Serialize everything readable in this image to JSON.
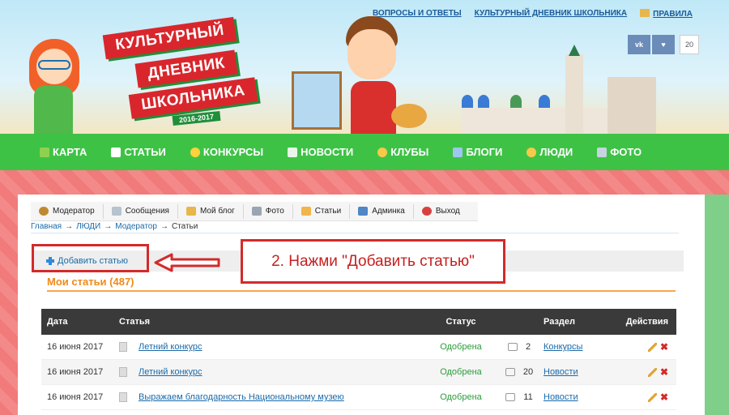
{
  "header": {
    "top_links": [
      "ВОПРОСЫ И ОТВЕТЫ",
      "КУЛЬТУРНЫЙ ДНЕВНИК ШКОЛЬНИКА",
      "ПРАВИЛА"
    ],
    "logo_lines": [
      "КУЛЬТУРНЫЙ",
      "ДНЕВНИК",
      "ШКОЛЬНИКА"
    ],
    "logo_year": "2016-2017",
    "social": {
      "vk": "vk",
      "like": "♥",
      "count": "20"
    }
  },
  "nav": [
    {
      "label": "КАРТА",
      "icon": "check-icon",
      "color": "#8fd14f"
    },
    {
      "label": "СТАТЬИ",
      "icon": "page-icon",
      "color": "#ffffff"
    },
    {
      "label": "КОНКУРСЫ",
      "icon": "bulb-icon",
      "color": "#ffd23c"
    },
    {
      "label": "НОВОСТИ",
      "icon": "doc-icon",
      "color": "#e8f5e8"
    },
    {
      "label": "КЛУБЫ",
      "icon": "people-icon",
      "color": "#f7c94b"
    },
    {
      "label": "БЛОГИ",
      "icon": "list-icon",
      "color": "#9ec7f0"
    },
    {
      "label": "ЛЮДИ",
      "icon": "people-icon",
      "color": "#f7c94b"
    },
    {
      "label": "ФОТО",
      "icon": "camera-icon",
      "color": "#c8d3e0"
    }
  ],
  "usertools": [
    {
      "label": "Модератор",
      "icon": "user-icon",
      "color": "#c0892f"
    },
    {
      "label": "Сообщения",
      "icon": "mail-icon",
      "color": "#b7c3cf"
    },
    {
      "label": "Мой блог",
      "icon": "book-icon",
      "color": "#e8b64a"
    },
    {
      "label": "Фото",
      "icon": "camera-icon",
      "color": "#9aa5b1"
    },
    {
      "label": "Статьи",
      "icon": "folder-icon",
      "color": "#f2b54a"
    },
    {
      "label": "Админка",
      "icon": "database-icon",
      "color": "#4f86c6"
    },
    {
      "label": "Выход",
      "icon": "exit-icon",
      "color": "#d84040"
    }
  ],
  "breadcrumb": {
    "items": [
      "Главная",
      "ЛЮДИ",
      "Модератор",
      "Статьи"
    ],
    "sep": "→"
  },
  "add_article": "Добавить статью",
  "callout": "2. Нажми \"Добавить статью\"",
  "section_title": "Мои статьи (487)",
  "table": {
    "headers": [
      "Дата",
      "Статья",
      "Статус",
      "Раздел",
      "Действия"
    ],
    "rows": [
      {
        "date": "16 июня 2017",
        "title": "Летний конкурс",
        "status": "Одобрена",
        "comments": "2",
        "section": "Конкурсы"
      },
      {
        "date": "16 июня 2017",
        "title": "Летний конкурс",
        "status": "Одобрена",
        "comments": "20",
        "section": "Новости"
      },
      {
        "date": "16 июня 2017",
        "title": "Выражаем благодарность Национальному музею",
        "status": "Одобрена",
        "comments": "11",
        "section": "Новости"
      }
    ]
  }
}
